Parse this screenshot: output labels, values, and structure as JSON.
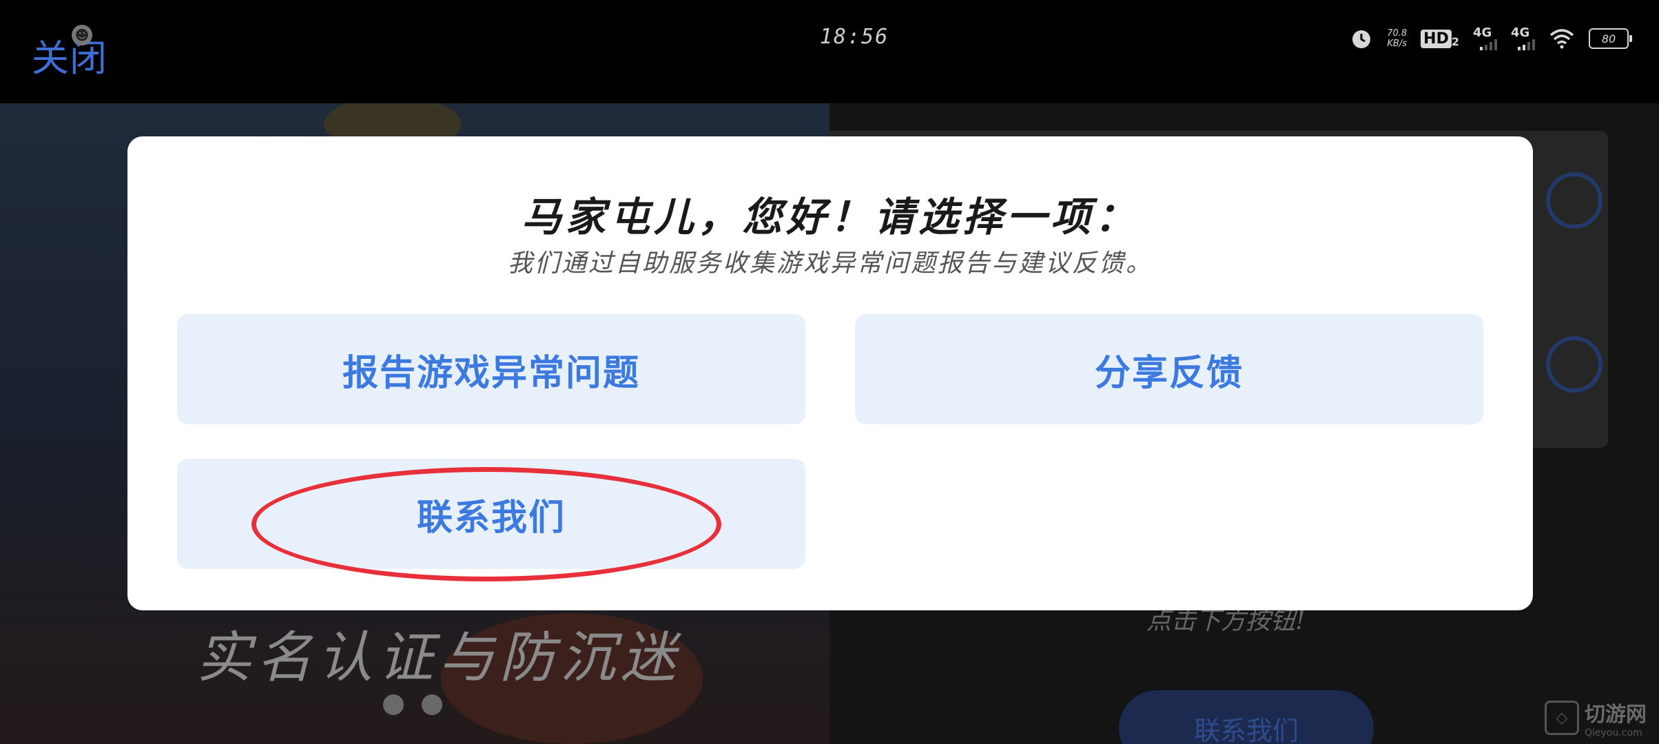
{
  "status_bar": {
    "close_label": "关闭",
    "clock": "18:56",
    "net_speed_value": "70.8",
    "net_speed_unit": "KB/s",
    "hd_label": "HD",
    "hd_sub": "2",
    "sim1_label": "4G",
    "sim2_label": "4G",
    "battery_level": "80",
    "icons": [
      "alarm-icon",
      "hd-voice-icon",
      "signal-icon",
      "wifi-icon",
      "battery-icon"
    ]
  },
  "background": {
    "banner_text": "实名认证与防沉迷",
    "hint_text": "点击下方按钮!",
    "button_label": "联系我们",
    "watermark_name": "切游网",
    "watermark_url": "Qieyou.com"
  },
  "dialog": {
    "title": "马家屯儿，您好！请选择一项：",
    "subtitle": "我们通过自助服务收集游戏异常问题报告与建议反馈。",
    "options": [
      {
        "label": "报告游戏异常问题"
      },
      {
        "label": "分享反馈"
      },
      {
        "label": "联系我们"
      }
    ],
    "highlight_color": "#e8303a",
    "accent_color": "#3c7ae0"
  }
}
